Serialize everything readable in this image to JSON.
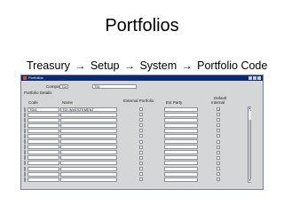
{
  "slide": {
    "title": "Portfolios",
    "breadcrumb": [
      "Treasury",
      "Setup",
      "System",
      "Portfolio Code"
    ]
  },
  "window": {
    "title": "Portfolios",
    "company_label": "Company",
    "company_code": "TDI",
    "company_name": "TDI",
    "section_title": "Portfolio Details"
  },
  "columns": {
    "code": "Code",
    "name": "Name",
    "external_portfolio": "External Portfolio",
    "ext_party": "Ext Party",
    "default": "Default",
    "internal": "Internal"
  },
  "rows": [
    {
      "code": "TDI1",
      "name": "TDI INVESTEMENT",
      "external": false,
      "internal": true
    },
    {
      "code": "",
      "name": "",
      "external": false,
      "internal": false
    },
    {
      "code": "",
      "name": "",
      "external": false,
      "internal": false
    },
    {
      "code": "",
      "name": "",
      "external": false,
      "internal": false
    },
    {
      "code": "",
      "name": "",
      "external": false,
      "internal": false
    },
    {
      "code": "",
      "name": "",
      "external": false,
      "internal": false
    },
    {
      "code": "",
      "name": "",
      "external": false,
      "internal": false
    },
    {
      "code": "",
      "name": "",
      "external": false,
      "internal": false
    },
    {
      "code": "",
      "name": "",
      "external": false,
      "internal": false
    },
    {
      "code": "",
      "name": "",
      "external": false,
      "internal": false
    },
    {
      "code": "",
      "name": "",
      "external": false,
      "internal": false
    },
    {
      "code": "",
      "name": "",
      "external": false,
      "internal": false
    },
    {
      "code": "",
      "name": "",
      "external": false,
      "internal": false
    },
    {
      "code": "",
      "name": "",
      "external": false,
      "internal": false
    }
  ],
  "colors": {
    "titlebar": "#0a2a78",
    "window_bg": "#d4d6d8",
    "active_row_indicator": "#1d4fa6"
  },
  "icons": [
    "app-icon",
    "minimize-icon",
    "maximize-icon",
    "close-icon",
    "arrow-right-icon",
    "scroll-up-icon",
    "scroll-down-icon",
    "checkmark-icon"
  ]
}
